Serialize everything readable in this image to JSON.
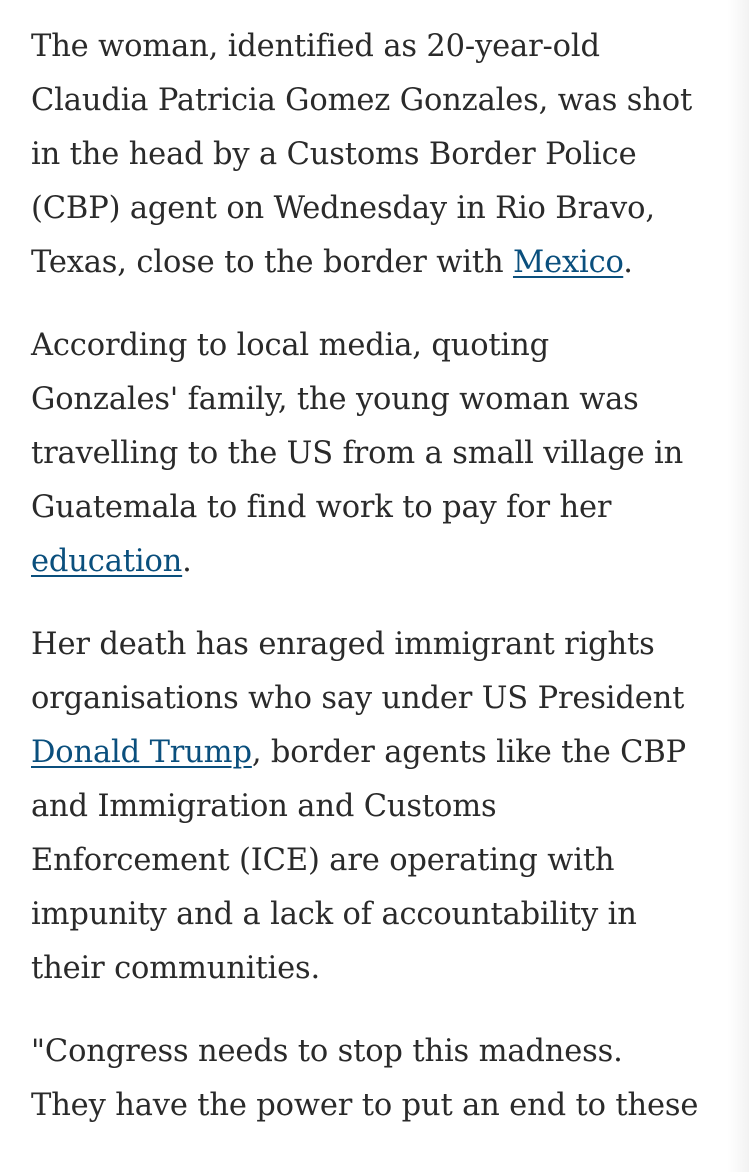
{
  "article": {
    "p1": {
      "l1": "The woman, identified as 20-year-old",
      "l2": "Claudia Patricia Gomez Gonzales, was shot",
      "l3": "in the head by a Customs Border Police",
      "l4": "(CBP) agent on Wednesday in Rio Bravo,",
      "l5_pre": "Texas, close to the border with ",
      "l5_link": "Mexico",
      "l5_post": "."
    },
    "p2": {
      "l1": "According to local media, quoting",
      "l2": "Gonzales' family, the young woman was",
      "l3": "travelling to the US from a small village in",
      "l4": "Guatemala to find work to pay for her",
      "l5_link": "education",
      "l5_post": "."
    },
    "p3": {
      "l1": "Her death has enraged immigrant rights",
      "l2": "organisations who say under US President",
      "l3_link": "Donald Trump",
      "l3_post": ", border agents like the CBP",
      "l4": "and Immigration and Customs",
      "l5": "Enforcement (ICE) are operating with",
      "l6": "impunity and a lack of accountability in",
      "l7": "their communities."
    },
    "p4": {
      "l1": "\"Congress needs to stop this madness.",
      "l2": "They have the power to put an end to these"
    }
  },
  "colors": {
    "text": "#2a2a2a",
    "link": "#0a4f7d",
    "background": "#ffffff"
  }
}
